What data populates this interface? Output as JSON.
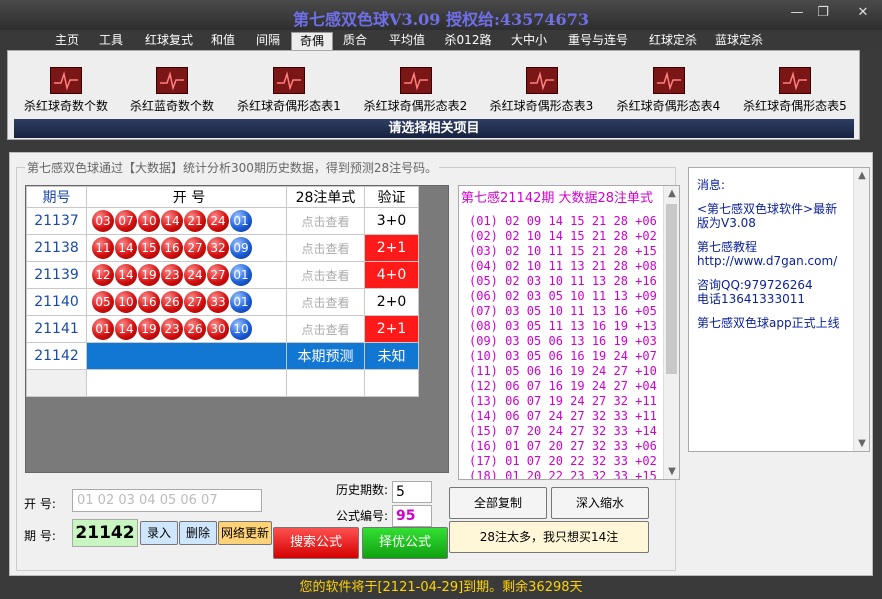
{
  "window": {
    "title": "第七感双色球V3.09  授权给:43574673",
    "minimize": "—",
    "restore": "❐",
    "close": "✕"
  },
  "menu": [
    "主页",
    "工具",
    "红球复式",
    "和值",
    "间隔",
    "奇偶",
    "质合",
    "平均值",
    "杀012路",
    "大中小",
    "重号与连号",
    "红球定杀",
    "蓝球定杀"
  ],
  "toolbar": {
    "items": [
      "杀红球奇数个数",
      "杀红蓝奇数个数",
      "杀红球奇偶形态表1",
      "杀红球奇偶形态表2",
      "杀红球奇偶形态表3",
      "杀红球奇偶形态表4",
      "杀红球奇偶形态表5"
    ],
    "footer": "请选择相关项目"
  },
  "main": {
    "caption": "第七感双色球通过【大数据】统计分析300期历史数据，得到预测28注号码。",
    "headers": {
      "issue": "期号",
      "draw": "开      号",
      "single": "28注单式",
      "verify": "验证"
    },
    "rows": [
      {
        "issue": "21137",
        "reds": [
          "03",
          "07",
          "10",
          "14",
          "21",
          "24"
        ],
        "blue": "01",
        "check": "点击查看",
        "verify": "3+0",
        "hit": false
      },
      {
        "issue": "21138",
        "reds": [
          "11",
          "14",
          "15",
          "16",
          "27",
          "32"
        ],
        "blue": "09",
        "check": "点击查看",
        "verify": "2+1",
        "hit": true
      },
      {
        "issue": "21139",
        "reds": [
          "12",
          "14",
          "19",
          "23",
          "24",
          "27"
        ],
        "blue": "01",
        "check": "点击查看",
        "verify": "4+0",
        "hit": true
      },
      {
        "issue": "21140",
        "reds": [
          "05",
          "10",
          "16",
          "26",
          "27",
          "33"
        ],
        "blue": "01",
        "check": "点击查看",
        "verify": "2+0",
        "hit": false
      },
      {
        "issue": "21141",
        "reds": [
          "01",
          "14",
          "19",
          "23",
          "26",
          "30"
        ],
        "blue": "10",
        "check": "点击查看",
        "verify": "2+1",
        "hit": true
      }
    ],
    "predict": {
      "issue": "21142",
      "label": "本期预测",
      "status": "未知"
    }
  },
  "result": {
    "title": "第七感21142期 大数据28注单式",
    "lines": [
      "(01) 02 09 14 15 21 28 +06",
      "(02) 02 10 14 15 21 28 +02",
      "(03) 02 10 11 15 21 28 +15",
      "(04) 02 10 11 13 21 28 +08",
      "(05) 02 03 10 11 13 28 +16",
      "(06) 02 03 05 10 11 13 +09",
      "(07) 03 05 10 11 13 16 +05",
      "(08) 03 05 11 13 16 19 +13",
      "(09) 03 05 06 13 16 19 +03",
      "(10) 03 05 06 16 19 24 +07",
      "(11) 05 06 16 19 24 27 +10",
      "(12) 06 07 16 19 24 27 +04",
      "(13) 06 07 19 24 27 32 +11",
      "(14) 06 07 24 27 32 33 +11",
      "(15) 07 20 24 27 32 33 +14",
      "(16) 01 07 20 27 32 33 +06",
      "(17) 01 07 20 22 32 33 +02",
      "(18) 01 20 22 23 32 33 +15"
    ]
  },
  "controls": {
    "open_label": "开  号:",
    "open_placeholder": "01 02 03 04 05 06 07",
    "issue_label": "期  号:",
    "issue_value": "21142",
    "enter": "录入",
    "delete": "删除",
    "update": "网络更新",
    "history_label": "历史期数:",
    "history_value": "5",
    "formula_label": "公式编号:",
    "formula_value": "95",
    "search": "搜索公式",
    "select": "择优公式",
    "copy_all": "全部复制",
    "shrink": "深入缩水",
    "fourteen": "28注太多，我只想买14注"
  },
  "side": {
    "lines": [
      "消息:",
      "<第七感双色球软件>最新版为V3.08",
      "第七感教程\nhttp://www.d7gan.com/",
      "咨询QQ:979726264\n电话13641333011",
      "第七感双色球app正式上线"
    ]
  },
  "status": "您的软件将于[2121-04-29]到期。剩余36298天",
  "colors": {
    "red_ball": "#d41010",
    "blue_ball": "#1c5ed8",
    "hit": "#ff1a1a",
    "predict": "#1277d3",
    "result_text": "#d000d0"
  }
}
